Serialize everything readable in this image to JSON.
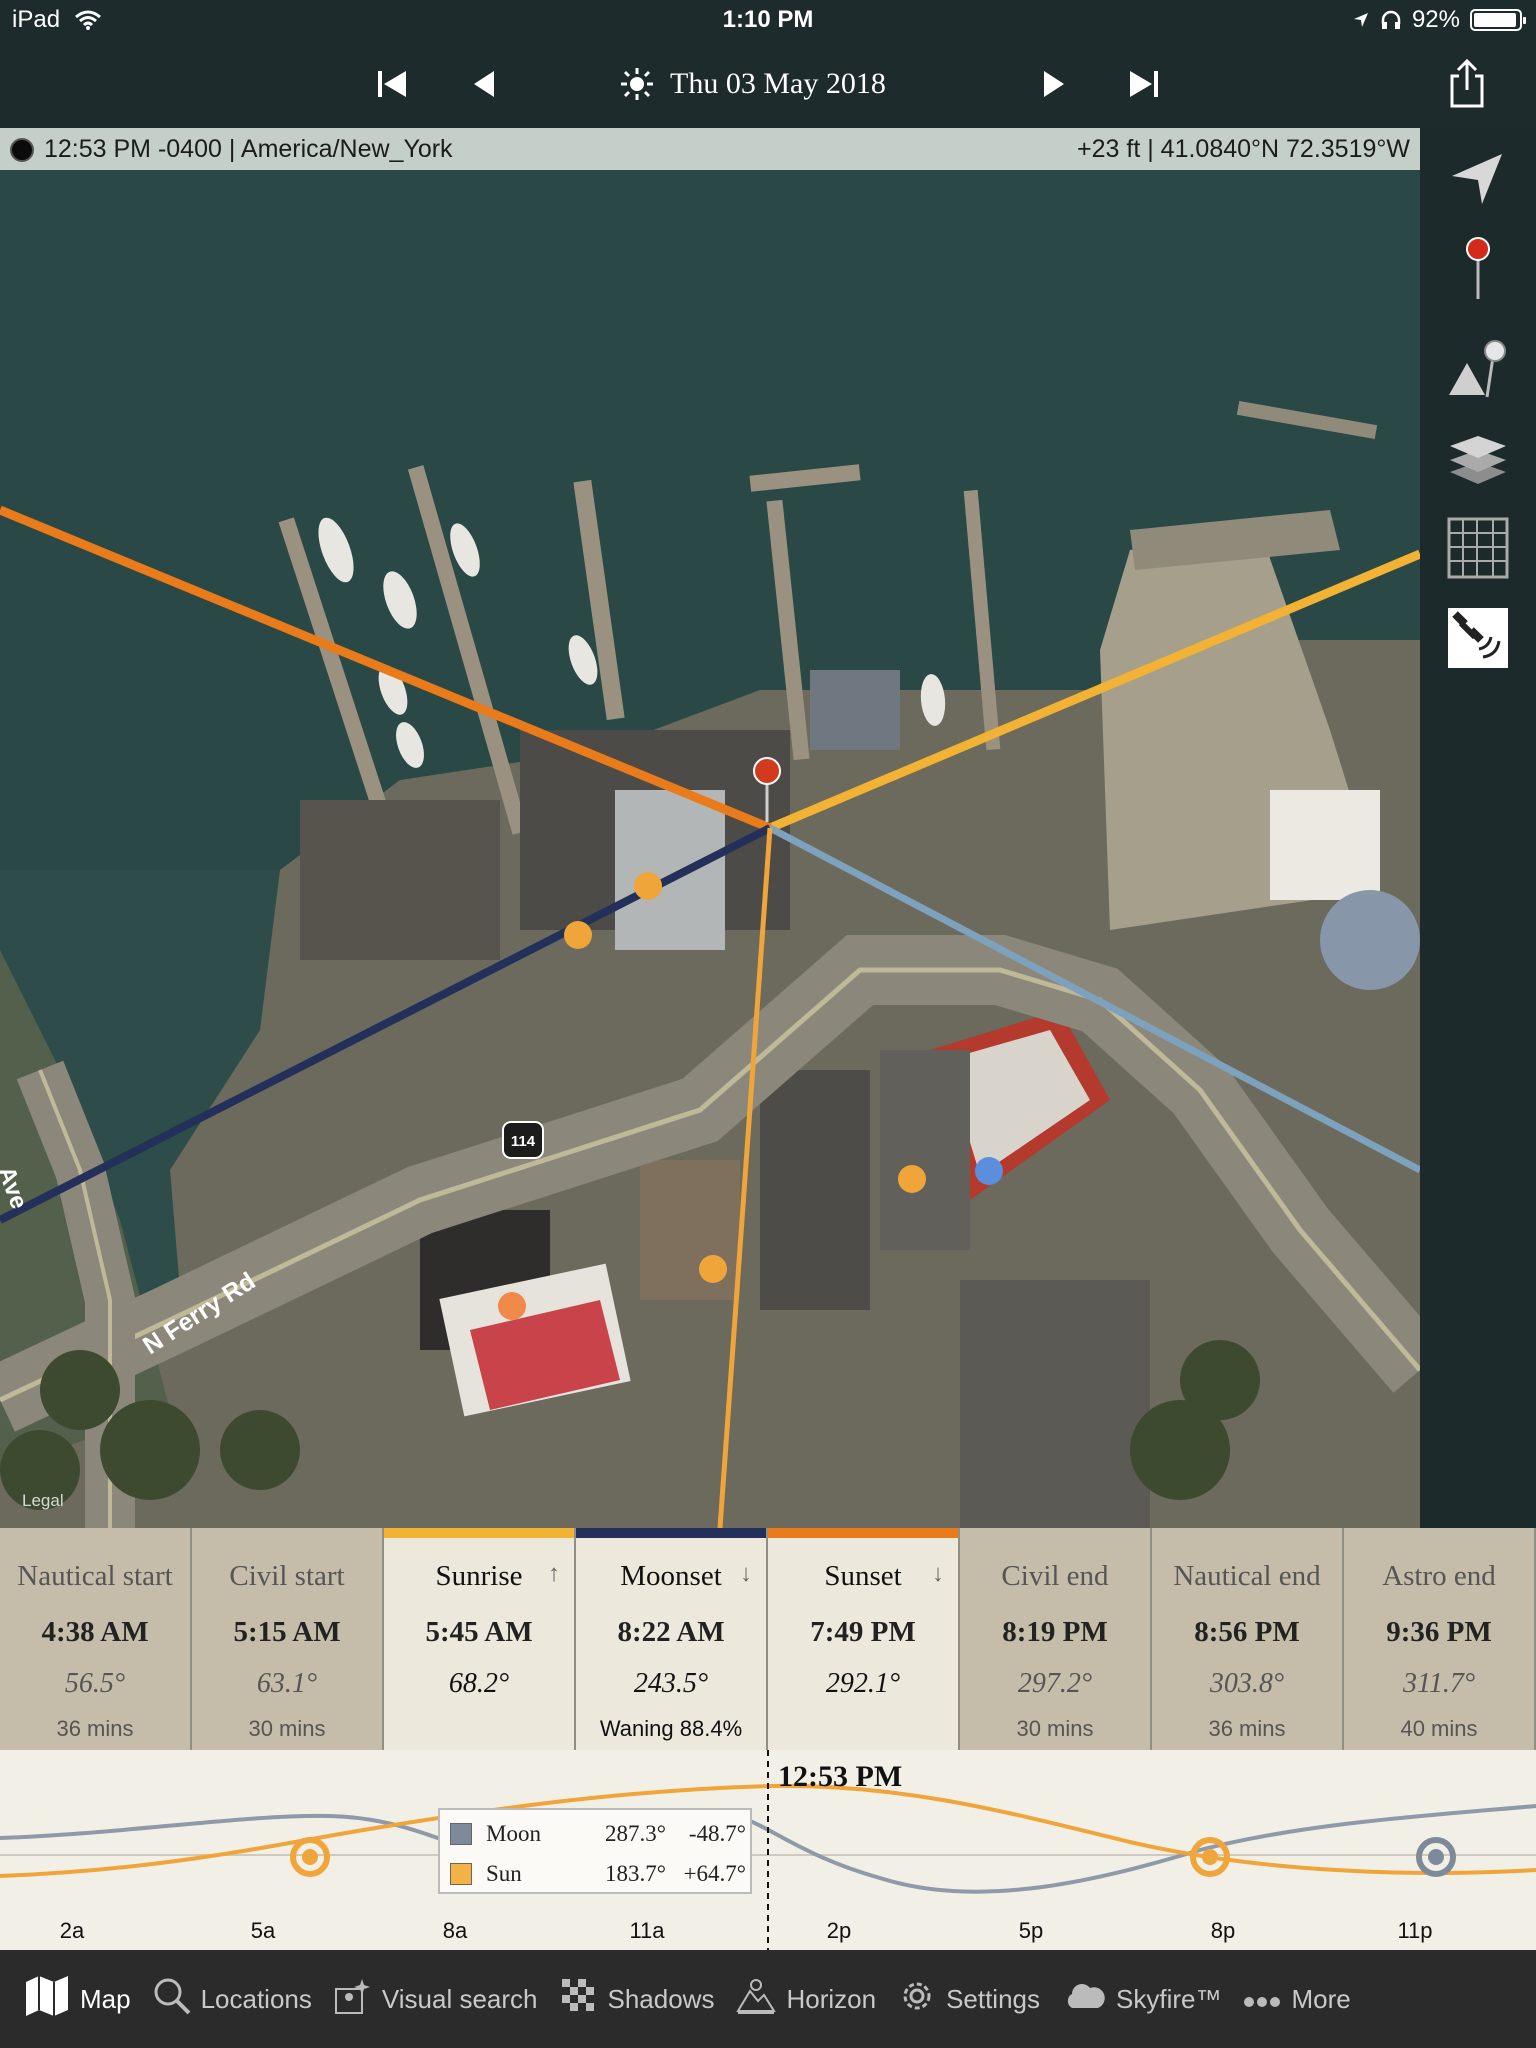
{
  "status_bar": {
    "device": "iPad",
    "time": "1:10 PM",
    "battery": "92%"
  },
  "header": {
    "date": "Thu 03 May 2018"
  },
  "info": {
    "time_zone": "12:53 PM -0400 | America/New_York",
    "location": "+23 ft | 41.0840°N 72.3519°W"
  },
  "map": {
    "road_label": "N Ferry Rd",
    "route_badge": "114",
    "partial_label": "Ave",
    "legal": "Legal",
    "line_colors": {
      "sunrise": "#f2b233",
      "sunset": "#ea7b1a",
      "moonrise": "#22305a",
      "moonset": "#7ea2bd",
      "sun_now": "#f0a53a"
    }
  },
  "toolbar": {
    "icons": [
      "navigation-arrow-icon",
      "red-pin-icon",
      "elevation-pin-icon",
      "layers-icon",
      "grid-icon",
      "satellite-icon"
    ]
  },
  "events": [
    {
      "title": "Nautical start",
      "time": "4:38 AM",
      "azimuth": "56.5°",
      "detail": "36 mins",
      "style": "dark",
      "bar": ""
    },
    {
      "title": "Civil start",
      "time": "5:15 AM",
      "azimuth": "63.1°",
      "detail": "30 mins",
      "style": "dark",
      "bar": ""
    },
    {
      "title": "Sunrise",
      "arrow": "↑",
      "time": "5:45 AM",
      "azimuth": "68.2°",
      "detail": "",
      "style": "light",
      "bar": "#f2b233"
    },
    {
      "title": "Moonset",
      "arrow": "↓",
      "time": "8:22 AM",
      "azimuth": "243.5°",
      "detail": "Waning 88.4%",
      "style": "light",
      "bar": "#22305a"
    },
    {
      "title": "Sunset",
      "arrow": "↓",
      "time": "7:49 PM",
      "azimuth": "292.1°",
      "detail": "",
      "style": "light",
      "bar": "#ea7b1a"
    },
    {
      "title": "Civil end",
      "time": "8:19 PM",
      "azimuth": "297.2°",
      "detail": "30 mins",
      "style": "dark",
      "bar": ""
    },
    {
      "title": "Nautical end",
      "time": "8:56 PM",
      "azimuth": "303.8°",
      "detail": "36 mins",
      "style": "dark",
      "bar": ""
    },
    {
      "title": "Astro end",
      "time": "9:36 PM",
      "azimuth": "311.7°",
      "detail": "40 mins",
      "style": "dark",
      "bar": ""
    }
  ],
  "graph": {
    "now_label": "12:53 PM",
    "x_labels": [
      "2a",
      "5a",
      "8a",
      "11a",
      "2p",
      "5p",
      "8p",
      "11p"
    ],
    "legend": [
      {
        "name": "Moon",
        "azimuth": "287.3°",
        "altitude": "-48.7°",
        "color": "#7d8a99"
      },
      {
        "name": "Sun",
        "azimuth": "183.7°",
        "altitude": "+64.7°",
        "color": "#f2b245"
      }
    ]
  },
  "tabs": [
    {
      "label": "Map",
      "icon": "map-icon",
      "active": true
    },
    {
      "label": "Locations",
      "icon": "search-icon",
      "active": false
    },
    {
      "label": "Visual search",
      "icon": "visual-search-icon",
      "active": false
    },
    {
      "label": "Shadows",
      "icon": "shadows-icon",
      "active": false
    },
    {
      "label": "Horizon",
      "icon": "horizon-icon",
      "active": false
    },
    {
      "label": "Settings",
      "icon": "gear-icon",
      "active": false
    },
    {
      "label": "Skyfire™",
      "icon": "cloud-icon",
      "active": false
    },
    {
      "label": "More",
      "icon": "more-icon",
      "active": false
    }
  ]
}
